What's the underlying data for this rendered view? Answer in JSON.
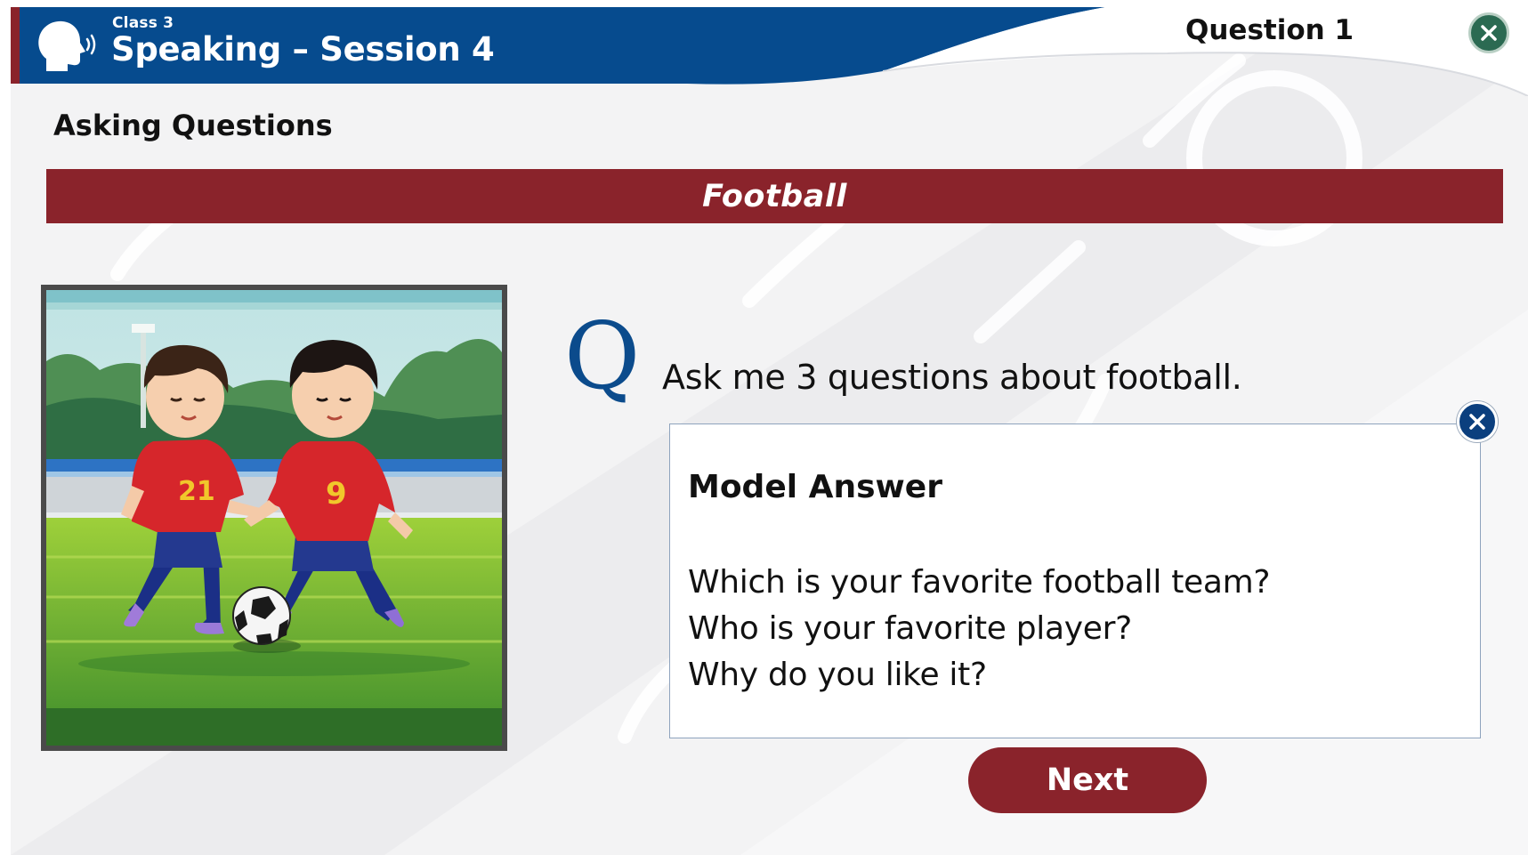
{
  "header": {
    "class_label": "Class 3",
    "session_title": "Speaking – Session 4",
    "question_label": "Question 1",
    "icon": "speaking-head-icon"
  },
  "lesson": {
    "section_title": "Asking Questions",
    "topic": "Football"
  },
  "image": {
    "shirt_numbers": [
      "21",
      "9"
    ]
  },
  "question": {
    "marker": "Q",
    "prompt": "Ask me 3 questions about football."
  },
  "model_answer": {
    "heading": "Model Answer",
    "lines": [
      "Which is your favorite football team?",
      "Who is your favorite player?",
      "Why do you like it?"
    ]
  },
  "buttons": {
    "next_label": "Next"
  },
  "colors": {
    "header_blue": "#064b8e",
    "accent_red": "#8a232b",
    "close_green": "#2b6a52",
    "close_blue": "#0b3f7e"
  }
}
